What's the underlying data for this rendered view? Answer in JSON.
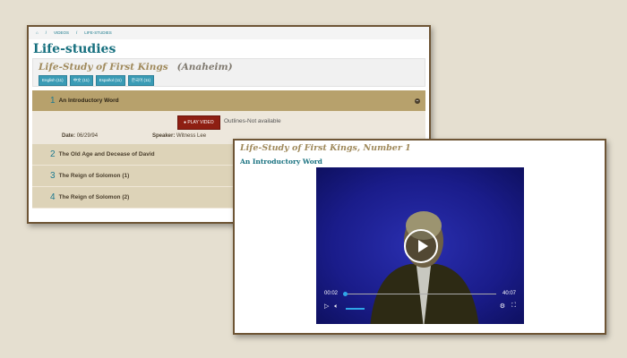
{
  "breadcrumb": {
    "home_icon": "home-icon",
    "items": [
      "VIDEOS",
      "LIFE-STUDIES"
    ]
  },
  "page_title": "Life-studies",
  "series": {
    "title": "Life-Study of First Kings",
    "location": "(Anaheim)",
    "languages": [
      "English (11)",
      "中文 (11)",
      "Español (11)",
      "한국어 (11)"
    ]
  },
  "messages": [
    {
      "number": "1",
      "title": "An Introductory Word"
    },
    {
      "number": "2",
      "title": "The Old Age and Decease of David"
    },
    {
      "number": "3",
      "title": "The Reign of Solomon (1)"
    },
    {
      "number": "4",
      "title": "The Reign of Solomon (2)"
    }
  ],
  "expanded": {
    "play_label": "PLAY VIDEO",
    "outlines": "Outlines-Not available",
    "date_label": "Date:",
    "date": "06/29/94",
    "speaker_label": "Speaker:",
    "speaker": "Witness Lee"
  },
  "player": {
    "title": "Life-Study of First Kings, Number 1",
    "subtitle": "An Introductory Word",
    "current_time": "00:02",
    "duration": "40:07",
    "progress": 0.001,
    "volume": 0.7
  }
}
